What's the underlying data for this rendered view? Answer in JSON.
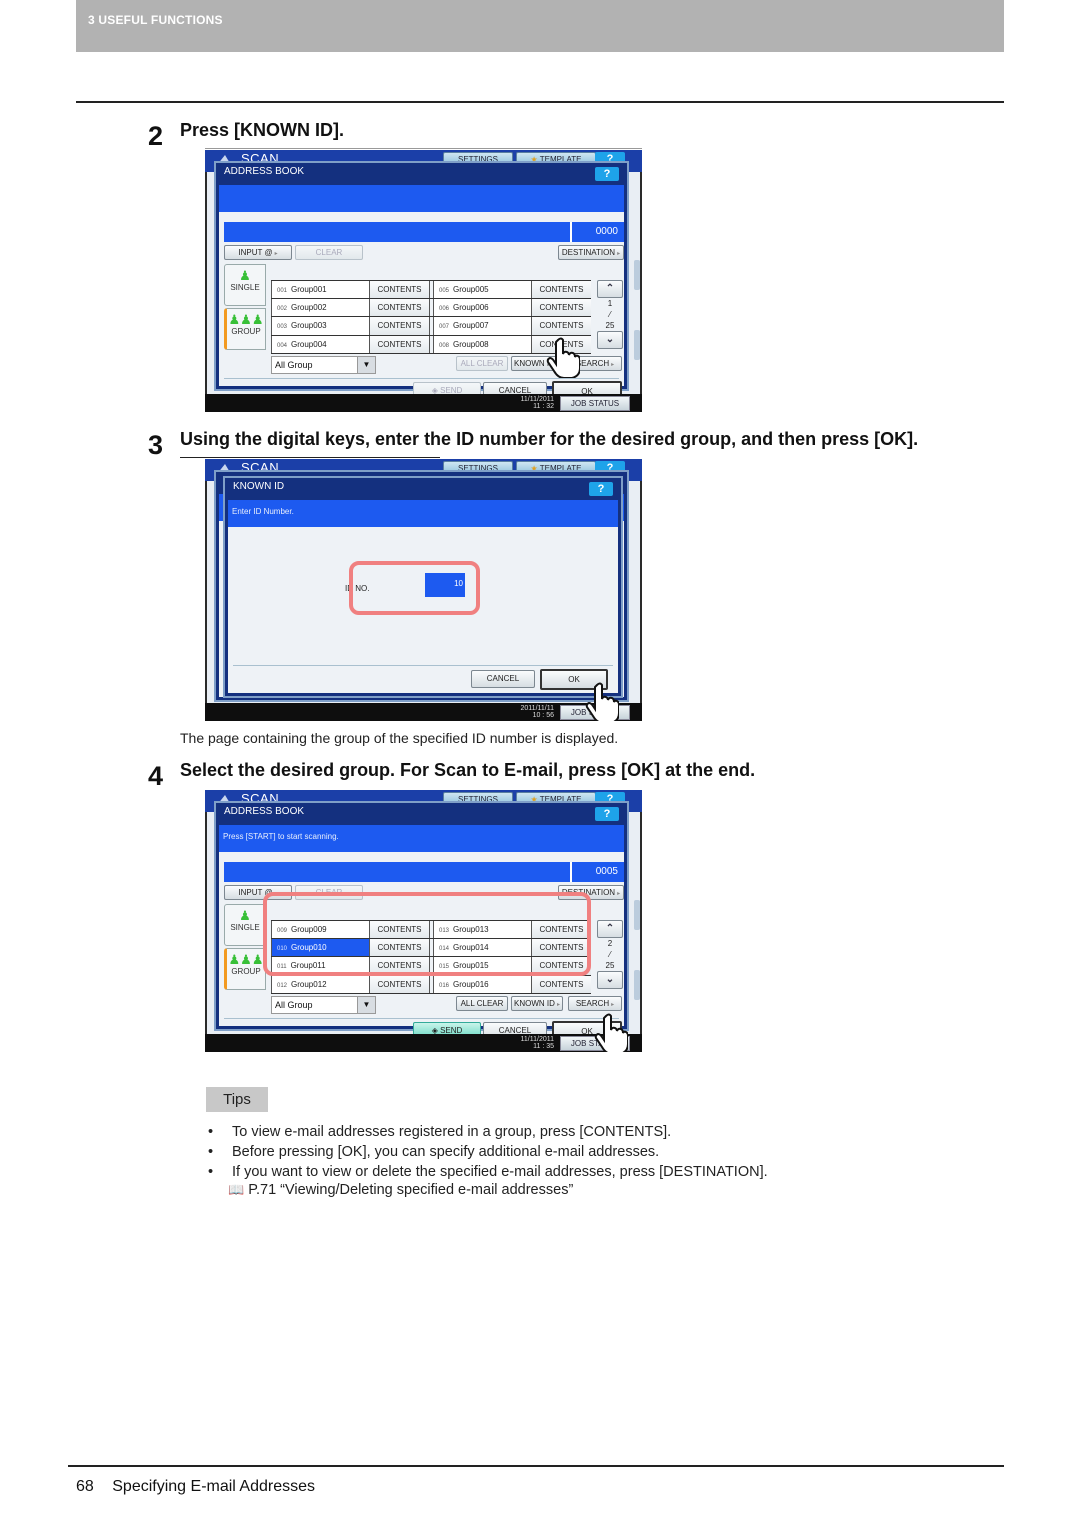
{
  "header": {
    "chapter": "3 USEFUL FUNCTIONS"
  },
  "steps": [
    {
      "number": "2",
      "text": "Press [KNOWN ID]."
    },
    {
      "number": "3",
      "text": "Using the digital keys, enter the ID number for the desired group, and then press [OK]."
    },
    {
      "number": "4",
      "text": "Select the desired group. For Scan to E-mail, press [OK] at the end."
    }
  ],
  "note_after_step3": "The page containing the group of the specified ID number is displayed.",
  "screen_common": {
    "app_title": "SCAN",
    "settings_tab": "SETTINGS",
    "template_tab": "TEMPLATE",
    "help": "?",
    "job_status": "JOB STATUS",
    "input_button": "INPUT @",
    "clear_button": "CLEAR",
    "destination_button": "DESTINATION",
    "single_tab": "SINGLE",
    "group_tab": "GROUP",
    "group_filter": "All Group",
    "all_clear_button": "ALL CLEAR",
    "known_id_button": "KNOWN ID",
    "search_button": "SEARCH",
    "send_button": "SEND",
    "cancel_button": "CANCEL",
    "ok_button": "OK",
    "contents_label": "CONTENTS"
  },
  "screen1": {
    "dialog_title": "ADDRESS BOOK",
    "message": "",
    "count": "0000",
    "page_current": "1",
    "page_total": "25",
    "date": "11/11/2011",
    "time": "11 : 32",
    "send_enabled": false,
    "all_clear_enabled": false,
    "left_column": [
      {
        "id": "001",
        "name": "Group001"
      },
      {
        "id": "002",
        "name": "Group002"
      },
      {
        "id": "003",
        "name": "Group003"
      },
      {
        "id": "004",
        "name": "Group004"
      }
    ],
    "right_column": [
      {
        "id": "005",
        "name": "Group005"
      },
      {
        "id": "006",
        "name": "Group006"
      },
      {
        "id": "007",
        "name": "Group007"
      },
      {
        "id": "008",
        "name": "Group008"
      }
    ]
  },
  "screen2": {
    "dialog_title": "KNOWN ID",
    "message": "Enter ID Number.",
    "id_label": "ID NO.",
    "id_value": "10",
    "date": "2011/11/11",
    "time": "10 : 56"
  },
  "screen3": {
    "dialog_title": "ADDRESS BOOK",
    "message": "Press [START] to start scanning.",
    "count": "0005",
    "page_current": "2",
    "page_total": "25",
    "date": "11/11/2011",
    "time": "11 : 35",
    "send_enabled": true,
    "all_clear_enabled": true,
    "selected_id": "010",
    "left_column": [
      {
        "id": "009",
        "name": "Group009"
      },
      {
        "id": "010",
        "name": "Group010"
      },
      {
        "id": "011",
        "name": "Group011"
      },
      {
        "id": "012",
        "name": "Group012"
      }
    ],
    "right_column": [
      {
        "id": "013",
        "name": "Group013"
      },
      {
        "id": "014",
        "name": "Group014"
      },
      {
        "id": "015",
        "name": "Group015"
      },
      {
        "id": "016",
        "name": "Group016"
      }
    ]
  },
  "tips": {
    "label": "Tips",
    "items": [
      "To view e-mail addresses registered in a group, press [CONTENTS].",
      "Before pressing [OK], you can specify additional e-mail addresses.",
      "If you want to view or delete the specified e-mail addresses, press [DESTINATION]."
    ],
    "reference": "P.71 “Viewing/Deleting specified e-mail addresses”"
  },
  "footer": {
    "page_number": "68",
    "title": "Specifying E-mail Addresses"
  },
  "colors": {
    "highlight": "#f08080",
    "screen_blue": "#1d5af0",
    "dialog_navy": "#14307f",
    "header_gray": "#b2b2b2"
  }
}
